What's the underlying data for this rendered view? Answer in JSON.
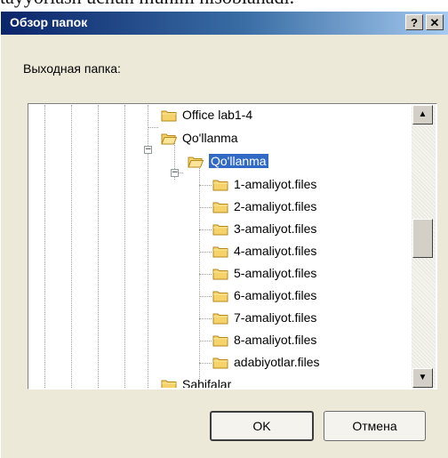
{
  "background_text": "tayyorlash uchun muhim hisoblanadi.",
  "dialog": {
    "title": "Обзор папок",
    "help_button": "?",
    "close_button": "✕",
    "prompt": "Выходная папка:",
    "ok_button": "OK",
    "cancel_button": "Отмена"
  },
  "tree": {
    "items": [
      {
        "label": "Office lab1-4"
      },
      {
        "label": "Qo'llanma"
      },
      {
        "label": "Qo'llanma"
      },
      {
        "label": "1-amaliyot.files"
      },
      {
        "label": "2-amaliyot.files"
      },
      {
        "label": "3-amaliyot.files"
      },
      {
        "label": "4-amaliyot.files"
      },
      {
        "label": "5-amaliyot.files"
      },
      {
        "label": "6-amaliyot.files"
      },
      {
        "label": "7-amaliyot.files"
      },
      {
        "label": "8-amaliyot.files"
      },
      {
        "label": "adabiyotlar.files"
      },
      {
        "label": "Sahifalar"
      }
    ],
    "expander_minus": "−",
    "selected_index": 2
  },
  "scrollbar": {
    "up_icon": "triangle-up-icon",
    "down_icon": "triangle-down-icon",
    "up_glyph": "▲",
    "down_glyph": "▼"
  },
  "colors": {
    "selection": "#316ac5",
    "folder_fill": "#f6d26a",
    "folder_stroke": "#b58a1b",
    "dialog_face": "#ece9d8"
  }
}
